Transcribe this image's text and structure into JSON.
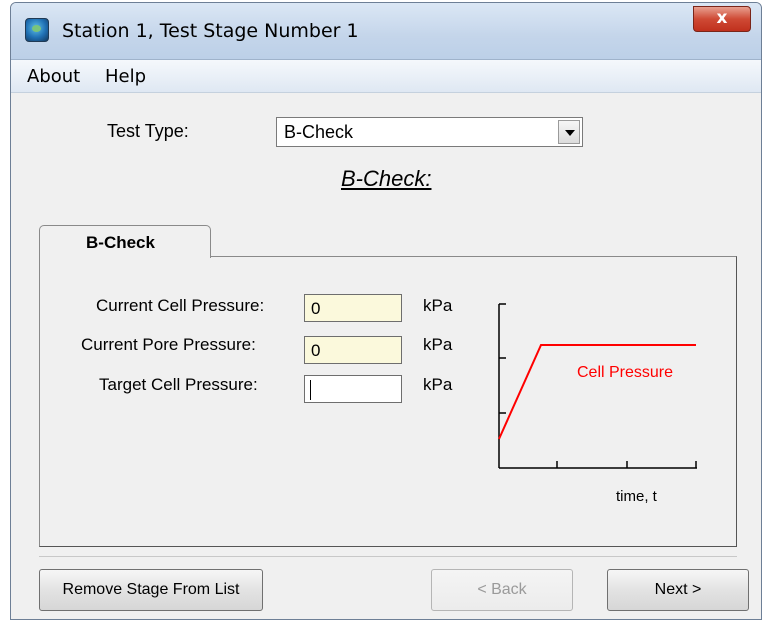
{
  "window": {
    "title": "Station 1, Test Stage Number 1",
    "close_glyph": "x"
  },
  "menu": {
    "items": [
      {
        "label": "About"
      },
      {
        "label": "Help"
      }
    ]
  },
  "test_type": {
    "label": "Test Type:",
    "selected": "B-Check"
  },
  "heading": "B-Check:",
  "tab": {
    "label": "B-Check"
  },
  "fields": [
    {
      "label": "Current Cell Pressure:",
      "value": "0",
      "unit": "kPa"
    },
    {
      "label": "Current Pore Pressure:",
      "value": "0",
      "unit": "kPa"
    },
    {
      "label": "Target Cell Pressure:",
      "value": "",
      "unit": "kPa"
    }
  ],
  "chart": {
    "series_label": "Cell Pressure",
    "x_label": "time, t",
    "line_color": "#ff0000"
  },
  "buttons": {
    "remove": "Remove Stage From List",
    "back": "< Back",
    "next": "Next >"
  }
}
